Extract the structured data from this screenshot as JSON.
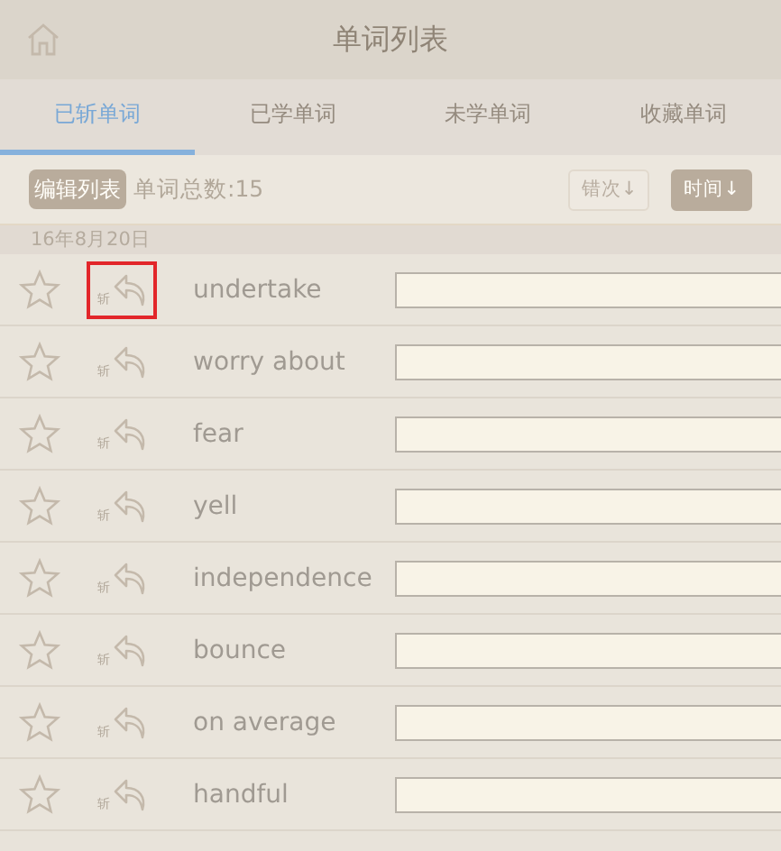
{
  "header": {
    "title": "单词列表"
  },
  "tabs": [
    {
      "label": "已斩单词",
      "selected": true
    },
    {
      "label": "已学单词",
      "selected": false
    },
    {
      "label": "未学单词",
      "selected": false
    },
    {
      "label": "收藏单词",
      "selected": false
    }
  ],
  "toolbar": {
    "edit_button": "编辑列表",
    "count": "单词总数:15",
    "sort_buttons": [
      {
        "label": "错次↓",
        "selected": false
      },
      {
        "label": "时间↓",
        "selected": true
      }
    ]
  },
  "date": "16年8月20日",
  "words": [
    {
      "word": "undertake",
      "icon_label": "斩",
      "starred": false,
      "highlighted": true
    },
    {
      "word": "worry about",
      "icon_label": "斩",
      "starred": false,
      "highlighted": false
    },
    {
      "word": "fear",
      "icon_label": "斩",
      "starred": false,
      "highlighted": false
    },
    {
      "word": "yell",
      "icon_label": "斩",
      "starred": false,
      "highlighted": false
    },
    {
      "word": "independence",
      "icon_label": "斩",
      "starred": false,
      "highlighted": false
    },
    {
      "word": "bounce",
      "icon_label": "斩",
      "starred": false,
      "highlighted": false
    },
    {
      "word": "on average",
      "icon_label": "斩",
      "starred": false,
      "highlighted": false
    },
    {
      "word": "handful",
      "icon_label": "斩",
      "starred": false,
      "highlighted": false
    }
  ]
}
